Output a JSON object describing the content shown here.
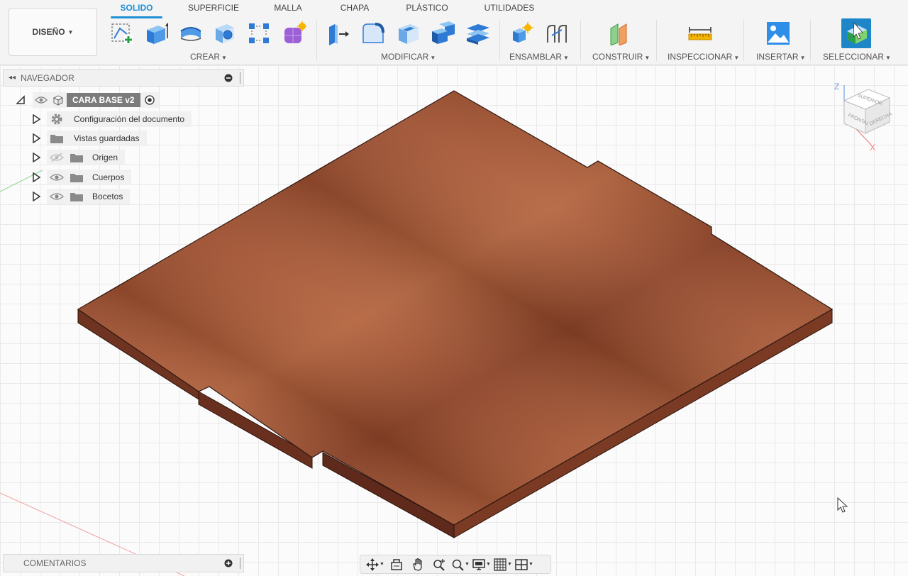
{
  "workspace": {
    "label": "DISEÑO"
  },
  "tabs": [
    {
      "label": "SOLIDO",
      "active": true
    },
    {
      "label": "SUPERFICIE",
      "active": false
    },
    {
      "label": "MALLA",
      "active": false
    },
    {
      "label": "CHAPA",
      "active": false
    },
    {
      "label": "PLÁSTICO",
      "active": false
    },
    {
      "label": "UTILIDADES",
      "active": false
    }
  ],
  "groups": {
    "crear": "CREAR",
    "modificar": "MODIFICAR",
    "ensamblar": "ENSAMBLAR",
    "construir": "CONSTRUIR",
    "inspeccionar": "INSPECCIONAR",
    "insertar": "INSERTAR",
    "seleccionar": "SELECCIONAR"
  },
  "tools": {
    "crear": [
      "create-sketch-icon",
      "extrude-icon",
      "revolve-icon",
      "hole-icon",
      "pattern-icon",
      "create-form-icon"
    ],
    "modificar": [
      "press-pull-icon",
      "fillet-icon",
      "shell-icon",
      "combine-icon",
      "offset-face-icon"
    ],
    "ensamblar": [
      "new-component-icon",
      "joint-icon"
    ],
    "construir": [
      "offset-plane-icon"
    ],
    "inspeccionar": [
      "measure-icon"
    ],
    "insertar": [
      "insert-image-icon"
    ],
    "seleccionar": [
      "select-icon"
    ]
  },
  "navigator": {
    "title": "NAVEGADOR",
    "root": {
      "label": "CARA BASE v2"
    },
    "items": [
      {
        "label": "Configuración del documento",
        "icon": "gear-icon"
      },
      {
        "label": "Vistas guardadas",
        "icon": "folder-icon"
      },
      {
        "label": "Origen",
        "icon": "folder-icon",
        "hidden": true
      },
      {
        "label": "Cuerpos",
        "icon": "folder-icon"
      },
      {
        "label": "Bocetos",
        "icon": "folder-icon"
      }
    ]
  },
  "comments": {
    "title": "COMENTARIOS"
  },
  "viewcube": {
    "top": "SUPERIOR",
    "front": "FRONTAL",
    "right": "DERECHA",
    "axis_z": "Z",
    "axis_x": "X"
  },
  "colors": {
    "accent": "#1f8fd6",
    "wood_top": "#a9583a",
    "wood_side": "#6b3020",
    "root_label_bg": "#7b7b7b"
  }
}
